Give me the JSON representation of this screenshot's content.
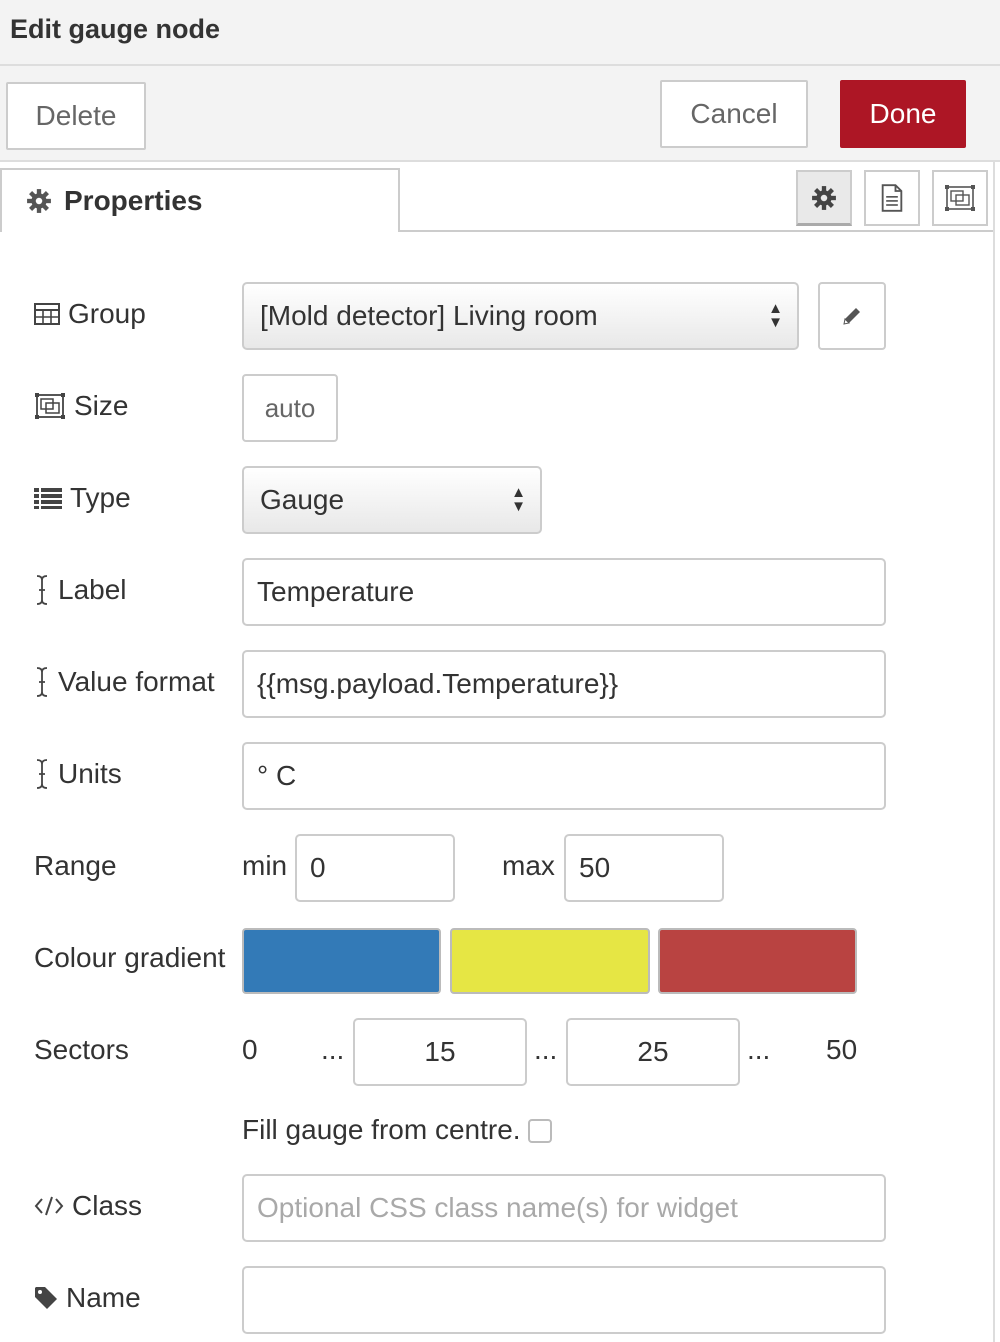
{
  "dialog": {
    "title": "Edit gauge node"
  },
  "tray": {
    "delete_label": "Delete",
    "cancel_label": "Cancel",
    "done_label": "Done"
  },
  "tabs": {
    "properties_label": "Properties"
  },
  "form": {
    "group": {
      "label": "Group",
      "value": "[Mold detector] Living room"
    },
    "size": {
      "label": "Size",
      "value": "auto"
    },
    "type": {
      "label": "Type",
      "value": "Gauge"
    },
    "label": {
      "label": "Label",
      "value": "Temperature"
    },
    "value_format": {
      "label": "Value format",
      "value": "{{msg.payload.Temperature}}"
    },
    "units": {
      "label": "Units",
      "value": "° C"
    },
    "range": {
      "label": "Range",
      "min_label": "min",
      "min_value": "0",
      "max_label": "max",
      "max_value": "50"
    },
    "colour_gradient": {
      "label": "Colour gradient",
      "colors": [
        "#337ab7",
        "#e6e644",
        "#b94341"
      ]
    },
    "sectors": {
      "label": "Sectors",
      "start": "0",
      "dots": "...",
      "sector1": "15",
      "sector2": "25",
      "end": "50"
    },
    "fill_from_centre": {
      "label": "Fill gauge from centre.",
      "checked": false
    },
    "class": {
      "label": "Class",
      "value": "",
      "placeholder": "Optional CSS class name(s) for widget"
    },
    "name": {
      "label": "Name",
      "value": ""
    }
  },
  "colors": {
    "primary_button": "#ad1625",
    "border": "#cccccc",
    "tray_bg": "#f3f3f3"
  }
}
